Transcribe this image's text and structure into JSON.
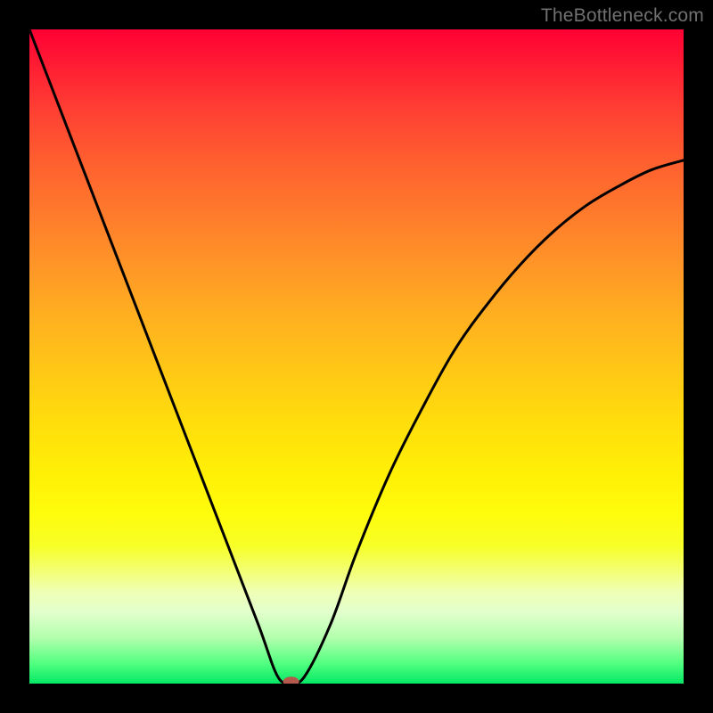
{
  "watermark": "TheBottleneck.com",
  "chart_data": {
    "type": "line",
    "title": "",
    "xlabel": "",
    "ylabel": "",
    "xlim": [
      0,
      100
    ],
    "ylim": [
      0,
      100
    ],
    "grid": false,
    "series": [
      {
        "name": "bottleneck-curve",
        "x": [
          0,
          5,
          10,
          15,
          20,
          25,
          30,
          35,
          38,
          40,
          42,
          46,
          50,
          55,
          60,
          65,
          70,
          75,
          80,
          85,
          90,
          95,
          100
        ],
        "values": [
          100,
          87,
          74,
          61,
          48,
          35,
          22,
          9,
          1,
          0.5,
          1,
          9,
          20,
          32,
          42,
          51,
          58,
          64,
          69,
          73,
          76,
          78.5,
          80
        ]
      }
    ],
    "marker": {
      "x": 40,
      "y": 0.3,
      "color": "#b35a4c"
    },
    "background_gradient": [
      {
        "pos": 0.0,
        "color": "#ff0033"
      },
      {
        "pos": 0.4,
        "color": "#ff9a28"
      },
      {
        "pos": 0.7,
        "color": "#fff008"
      },
      {
        "pos": 0.88,
        "color": "#e8ffc0"
      },
      {
        "pos": 1.0,
        "color": "#05e865"
      }
    ]
  }
}
